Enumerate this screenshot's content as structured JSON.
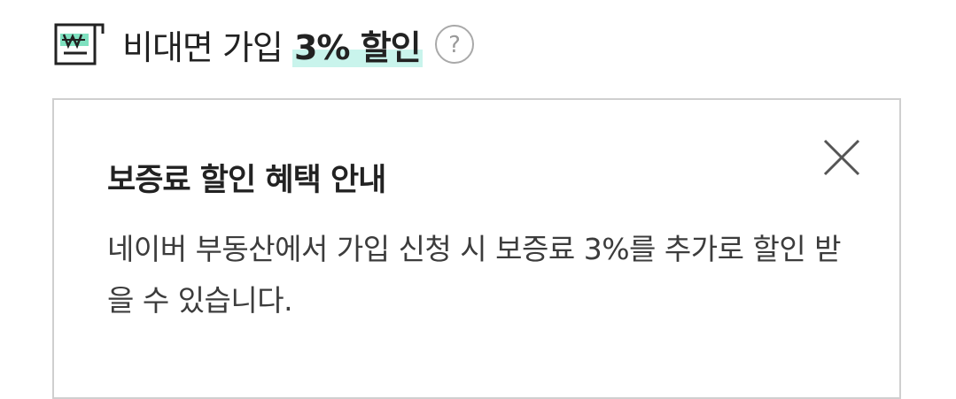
{
  "header": {
    "icon": "won-document-icon",
    "title_prefix": "비대면 가입 ",
    "title_highlight": "3% 할인",
    "help_icon": "question-circle-icon"
  },
  "card": {
    "title": "보증료 할인 혜택 안내",
    "body": "네이버 부동산에서 가입 신청 시 보증료 3%를 추가로 할인 받을 수 있습니다.",
    "close_icon": "close-icon"
  },
  "colors": {
    "highlight": "#c9f4ec",
    "icon_accent": "#5fd9b0",
    "border": "#cfcfcf",
    "text": "#222222"
  }
}
